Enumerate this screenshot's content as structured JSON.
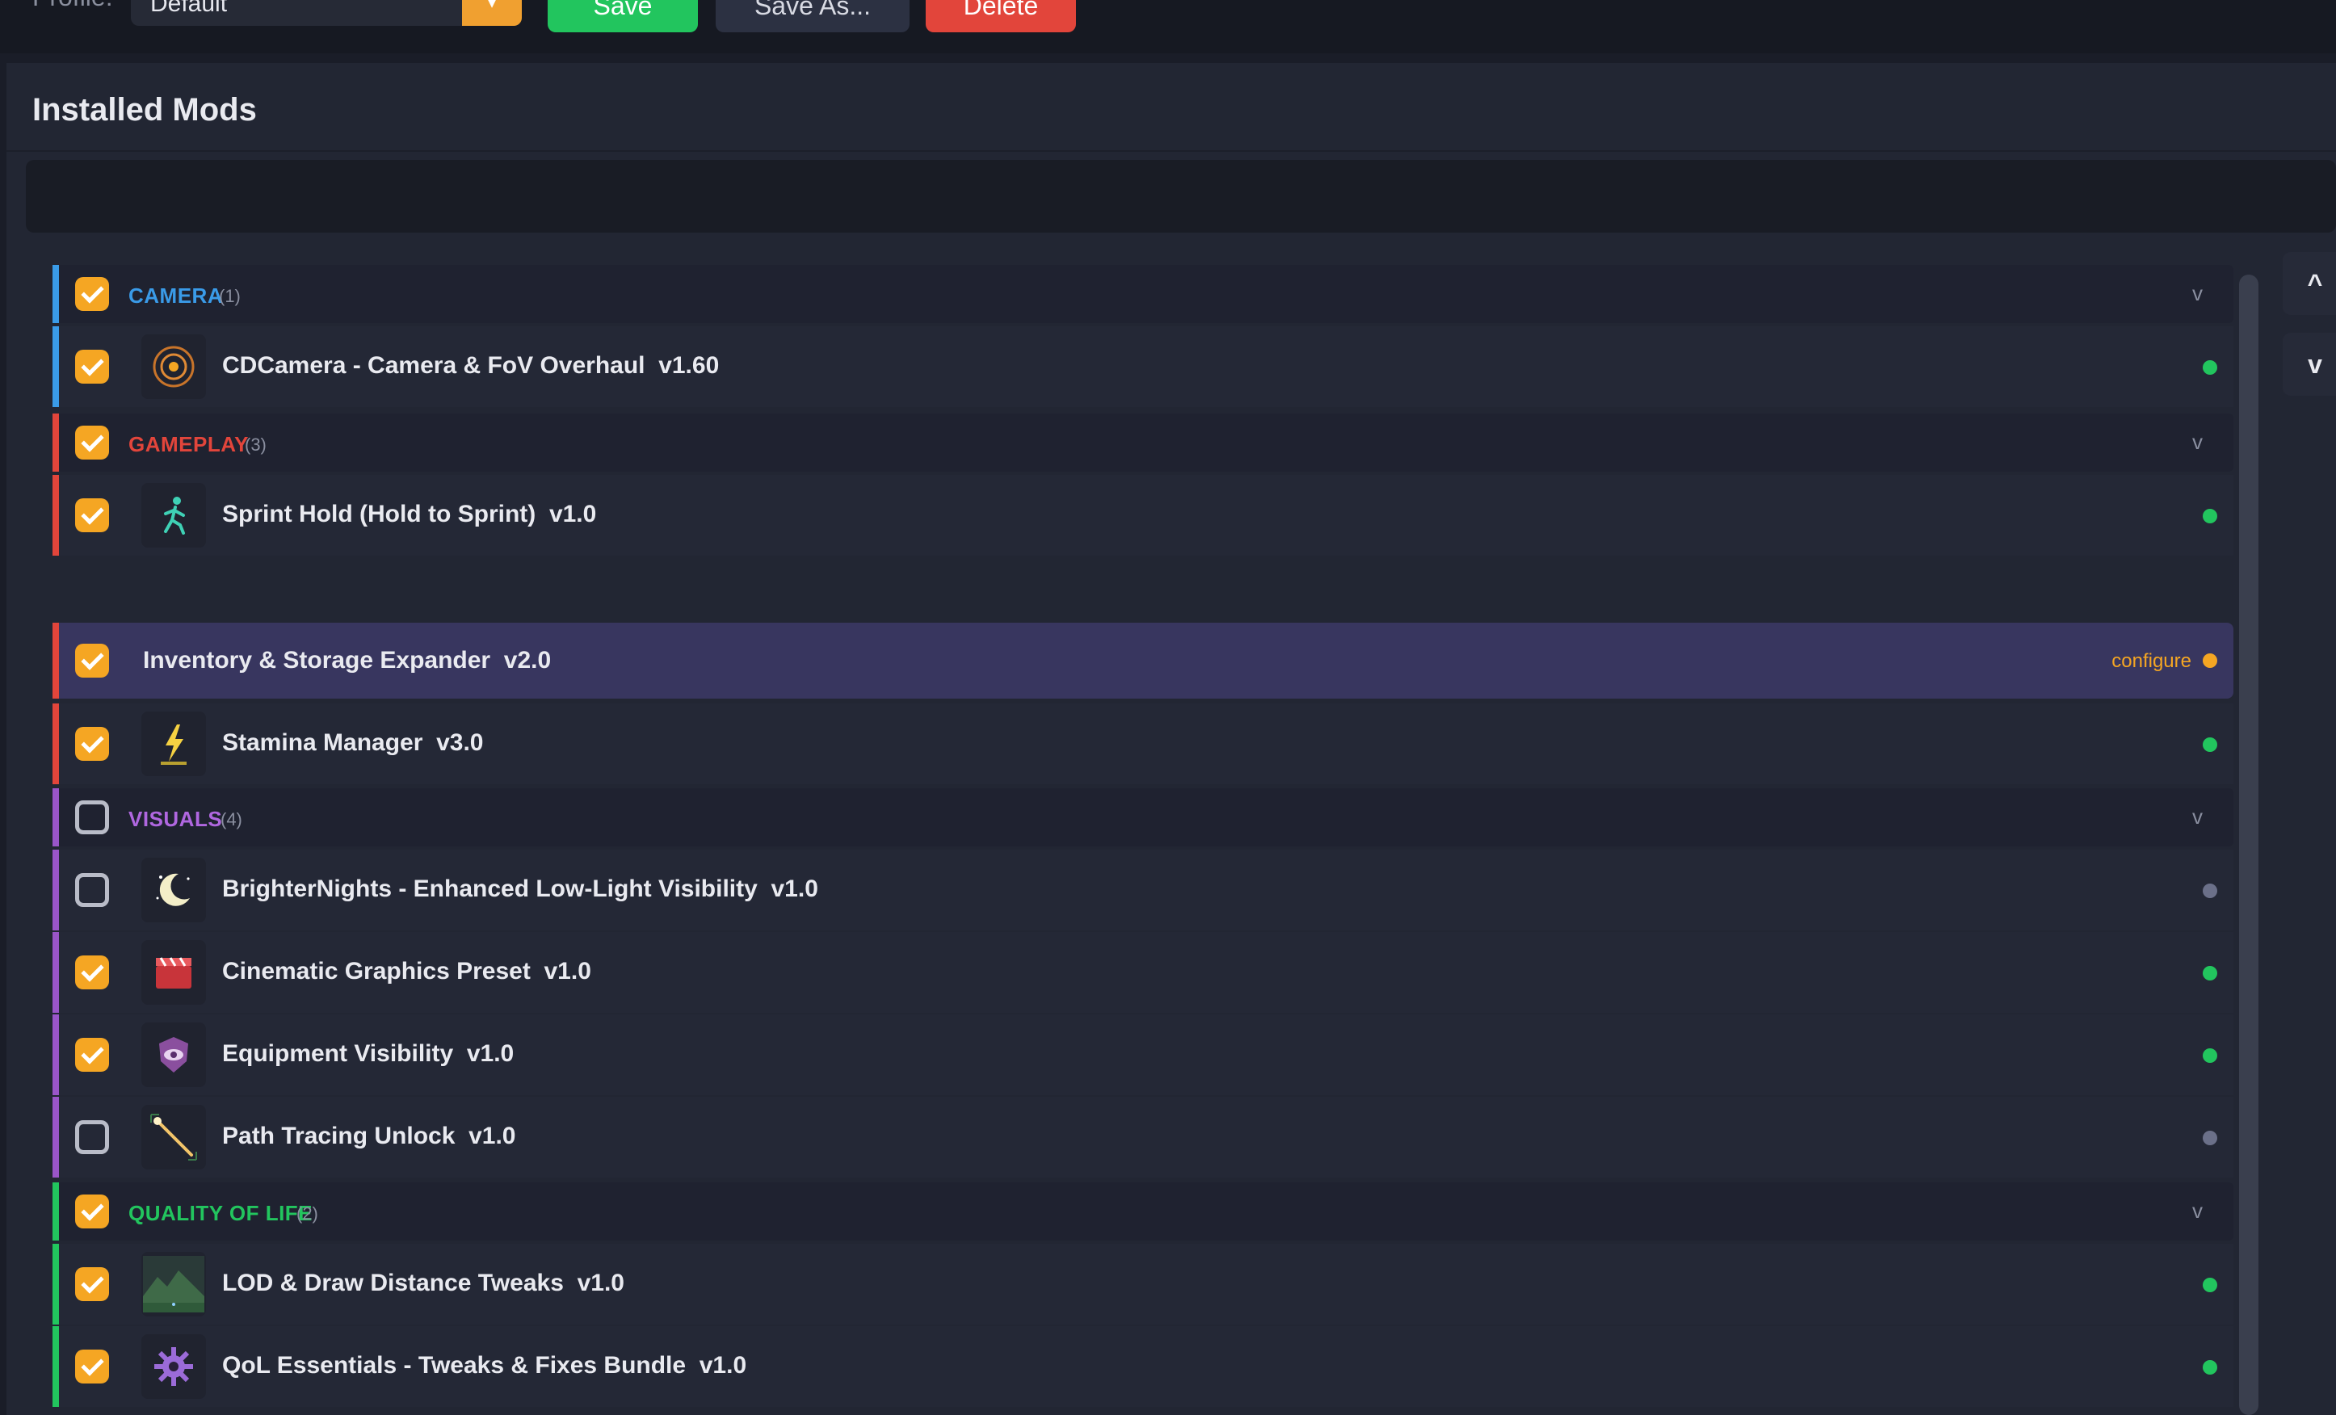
{
  "toolbar": {
    "profile_label": "Profile:",
    "profile_value": "Default",
    "save_label": "Save",
    "save_as_label": "Save As...",
    "delete_label": "Delete"
  },
  "panel": {
    "title": "Installed Mods"
  },
  "colors": {
    "camera": "#3a9be8",
    "gameplay": "#e2453b",
    "visuals": "#9a55c9",
    "quality_of_life": "#22c55e",
    "status_enabled": "#22c55e",
    "status_disabled": "#6b7089",
    "status_configure": "#f5a623",
    "checkbox_on": "#f5a623"
  },
  "categories": [
    {
      "name": "CAMERA",
      "count": "(1)",
      "checked": true,
      "chevron": "v"
    },
    {
      "name": "GAMEPLAY",
      "count": "(3)",
      "checked": true,
      "chevron": "v"
    },
    {
      "name": "VISUALS",
      "count": "(4)",
      "checked": false,
      "chevron": "v"
    },
    {
      "name": "QUALITY OF LIFE",
      "count": "(2)",
      "checked": true,
      "chevron": "v"
    }
  ],
  "mods": [
    {
      "name": "CDCamera - Camera & FoV Overhaul",
      "version": "v1.60",
      "checked": true,
      "icon": "camera-lens-icon",
      "status": "enabled"
    },
    {
      "name": "Sprint Hold (Hold to Sprint)",
      "version": "v1.0",
      "checked": true,
      "icon": "running-figure-icon",
      "status": "enabled"
    },
    {
      "name": "Inventory & Storage Expander",
      "version": "v2.0",
      "checked": true,
      "icon": "",
      "status": "configure",
      "configure_label": "configure",
      "selected": true
    },
    {
      "name": "Stamina Manager",
      "version": "v3.0",
      "checked": true,
      "icon": "lightning-icon",
      "status": "enabled"
    },
    {
      "name": "BrighterNights - Enhanced Low-Light Visibility",
      "version": "v1.0",
      "checked": false,
      "icon": "moon-icon",
      "status": "disabled"
    },
    {
      "name": "Cinematic Graphics Preset",
      "version": "v1.0",
      "checked": true,
      "icon": "clapperboard-icon",
      "status": "enabled"
    },
    {
      "name": "Equipment Visibility",
      "version": "v1.0",
      "checked": true,
      "icon": "eye-shield-icon",
      "status": "enabled"
    },
    {
      "name": "Path Tracing Unlock",
      "version": "v1.0",
      "checked": false,
      "icon": "light-ray-icon",
      "status": "disabled"
    },
    {
      "name": "LOD & Draw Distance Tweaks",
      "version": "v1.0",
      "checked": true,
      "icon": "landscape-icon",
      "status": "enabled"
    },
    {
      "name": "QoL Essentials - Tweaks & Fixes Bundle",
      "version": "v1.0",
      "checked": true,
      "icon": "gear-icon",
      "status": "enabled"
    }
  ],
  "nav": {
    "up_label": "^",
    "down_label": "v"
  }
}
